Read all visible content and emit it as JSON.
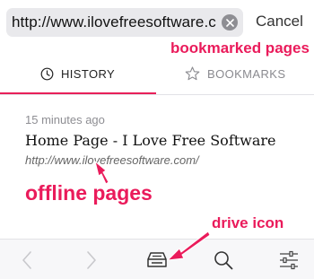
{
  "search": {
    "url": "http://www.ilovefreesoftware.c",
    "cancel_label": "Cancel"
  },
  "tabs": [
    {
      "label": "HISTORY",
      "icon": "clock-icon",
      "active": true
    },
    {
      "label": "BOOKMARKS",
      "icon": "star-icon",
      "active": false
    }
  ],
  "history": [
    {
      "time": "15 minutes ago",
      "title": "Home Page - I Love Free Software",
      "url": "http://www.ilovefreesoftware.com/"
    }
  ],
  "toolbar": {
    "icons": [
      "back-arrow-icon",
      "forward-arrow-icon",
      "drive-icon",
      "search-icon",
      "settings-sliders-icon"
    ]
  },
  "annotations": {
    "bookmarked": "bookmarked pages",
    "offline": "offline pages",
    "drive": "drive icon"
  },
  "colors": {
    "accent": "#e8205a",
    "annotation": "#ea1b5b"
  }
}
